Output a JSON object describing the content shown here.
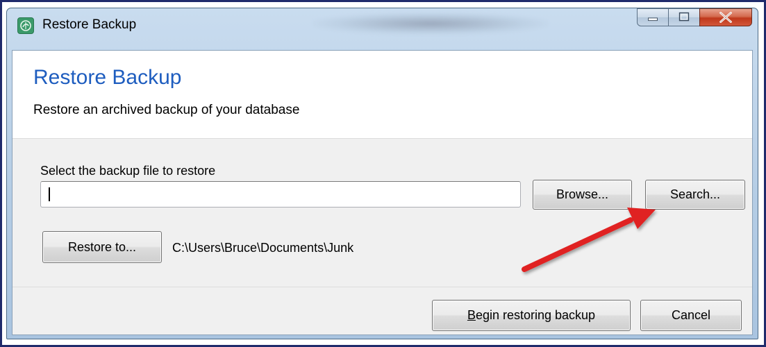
{
  "window": {
    "title": "Restore Backup",
    "controls": {
      "minimize": "minimize-icon",
      "maximize": "maximize-icon",
      "close": "close-icon"
    }
  },
  "header": {
    "heading": "Restore Backup",
    "subheading": "Restore an archived backup of your database"
  },
  "form": {
    "file_label": "Select the backup file to restore",
    "file_value": "",
    "browse_label": "Browse...",
    "search_label": "Search...",
    "restore_to_label": "Restore to...",
    "restore_path": "C:\\Users\\Bruce\\Documents\\Junk"
  },
  "footer": {
    "begin_prefix": "",
    "begin_mnemonic": "B",
    "begin_rest": "egin restoring backup",
    "cancel_label": "Cancel"
  },
  "colors": {
    "heading": "#1e5dbf",
    "annotation_arrow": "#e02020",
    "frame_border": "#1f2a6b"
  }
}
